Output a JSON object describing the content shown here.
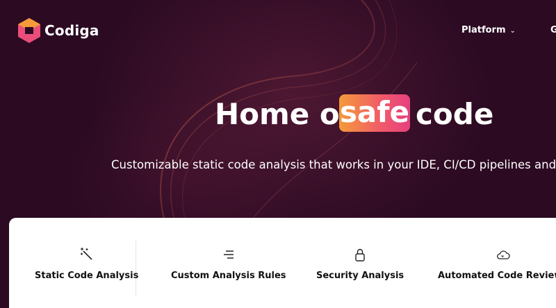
{
  "brand": {
    "name": "Codiga",
    "logo_icon": "codiga-logo-icon"
  },
  "nav": {
    "platform_label": "Platform",
    "next_label_cut": "G"
  },
  "hero": {
    "title_before": "Home of",
    "title_highlight": "safe",
    "title_after": "code",
    "subtitle": "Customizable static code analysis that works in your IDE, CI/CD pipelines and"
  },
  "features": [
    {
      "label": "Static Code Analysis",
      "icon": "magic-wand-icon"
    },
    {
      "label": "Custom Analysis Rules",
      "icon": "lines-icon"
    },
    {
      "label": "Security Analysis",
      "icon": "lock-icon"
    },
    {
      "label": "Automated Code Reviews",
      "icon": "cloud-icon"
    }
  ],
  "colors": {
    "background": "#2b0a22",
    "highlight_start": "#f59a3a",
    "highlight_end": "#e6407e"
  }
}
